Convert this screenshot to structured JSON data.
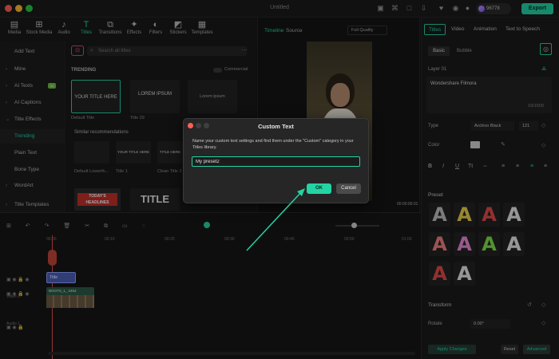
{
  "window": {
    "title": "Untitled",
    "credits": "96778",
    "export_label": "Export"
  },
  "toolbar": {
    "tools": [
      {
        "label": "Media",
        "icon": "media-icon"
      },
      {
        "label": "Stock Media",
        "icon": "stock-media-icon"
      },
      {
        "label": "Audio",
        "icon": "audio-icon"
      },
      {
        "label": "Titles",
        "icon": "titles-icon",
        "active": true
      },
      {
        "label": "Transitions",
        "icon": "transitions-icon"
      },
      {
        "label": "Effects",
        "icon": "effects-icon"
      },
      {
        "label": "Filters",
        "icon": "filters-icon"
      },
      {
        "label": "Stickers",
        "icon": "stickers-icon"
      },
      {
        "label": "Templates",
        "icon": "templates-icon"
      }
    ]
  },
  "sidebar": {
    "items": [
      {
        "label": "Add Text"
      },
      {
        "label": "Mine"
      },
      {
        "label": "AI Texts"
      },
      {
        "label": "AI Captions"
      },
      {
        "label": "Title Effects"
      },
      {
        "label": "Trending"
      },
      {
        "label": "Plain Text"
      },
      {
        "label": "Bone Type"
      },
      {
        "label": "WordArt"
      },
      {
        "label": "Title Templates"
      }
    ]
  },
  "library": {
    "search_placeholder": "Search all titles",
    "section": "TRENDING",
    "commercial_label": "Commercial",
    "thumbs": [
      {
        "text": "YOUR TITLE HERE",
        "caption": "Default Title"
      },
      {
        "text": "LOREM IPSUM",
        "caption": "Title 29"
      },
      {
        "text": "Lorem ipsum",
        "caption": ""
      }
    ],
    "similar_label": "Similar recommendations",
    "similar": [
      {
        "text": "",
        "caption": "Default Lowerth..."
      },
      {
        "text": "YOUR TITLE HERE",
        "caption": "Title 1"
      },
      {
        "text": "TITLE HERE",
        "caption": "Clean Title 2"
      }
    ],
    "bottom": [
      {
        "text": "TODAY'S HEADLINES"
      },
      {
        "text": "TITLE"
      }
    ]
  },
  "viewer": {
    "tabs": [
      "Timeline",
      "Source"
    ],
    "quality": "Full Quality",
    "timecode": "00:00:00:01"
  },
  "right_panel": {
    "tabs": [
      "Titles",
      "Video",
      "Animation",
      "Text to Speech"
    ],
    "subtabs": [
      "Basic",
      "Bubble"
    ],
    "layer": "Layer 01",
    "text_value": "Wondershare Filmora",
    "char_count": "19/1500",
    "type_label": "Type",
    "font": "Archivo Black",
    "font_size": "121",
    "color_label": "Color",
    "preset_label": "Preset",
    "transform_label": "Transform",
    "rotate_label": "Rotate",
    "rotate_value": "0.00°",
    "apply_label": "Apply Changes",
    "reset_label": "Reset",
    "advanced_label": "Advanced",
    "preset_colors": [
      "#bfbfbf",
      "#e8d04a",
      "#e04a4a",
      "#e6e6e6",
      "#f08080",
      "#e88ad8",
      "#7fe04a",
      "#e6e6e6",
      "#e04a4a",
      "#e6e6e6"
    ]
  },
  "timeline": {
    "ruler": [
      "00:00",
      "00:10",
      "00:20",
      "00:30",
      "00:40",
      "00:50",
      "01:00"
    ],
    "clip_title": "Title",
    "video_clip": "BOOTS_1_ 2464",
    "track_video_label": "Video 1",
    "track_audio_label": "Audio 1"
  },
  "dialog": {
    "title": "Custom Text",
    "message": "Name your custom text settings and find them under the \"Custom\" category in your Titles library.",
    "input_value": "My preset2",
    "ok_label": "OK",
    "cancel_label": "Cancel"
  }
}
